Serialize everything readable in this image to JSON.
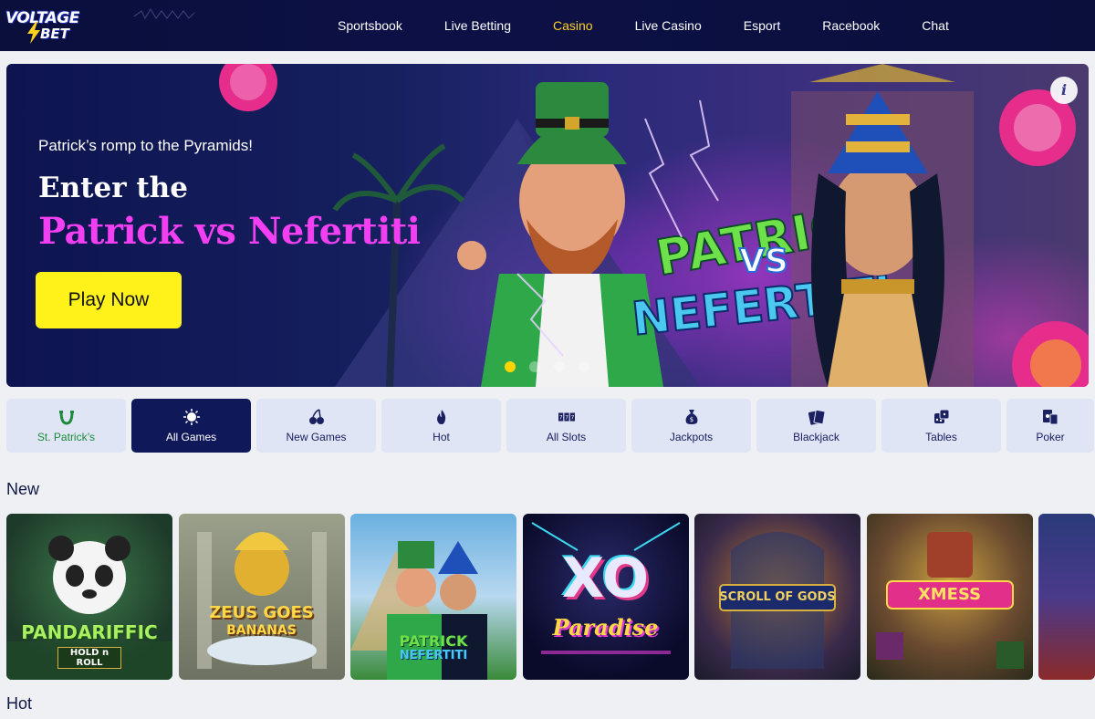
{
  "header": {
    "logo_line1": "VOLTAGE",
    "logo_line2": "BET",
    "nav": [
      {
        "label": "Sportsbook",
        "active": false
      },
      {
        "label": "Live Betting",
        "active": false
      },
      {
        "label": "Casino",
        "active": true
      },
      {
        "label": "Live Casino",
        "active": false
      },
      {
        "label": "Esport",
        "active": false
      },
      {
        "label": "Racebook",
        "active": false
      },
      {
        "label": "Chat",
        "active": false
      }
    ]
  },
  "hero": {
    "subtitle": "Patrick’s romp to the Pyramids!",
    "title_line1": "Enter the",
    "title_line2": "Patrick vs Nefertiti",
    "cta": "Play Now",
    "info_icon": "i",
    "art_text_1": "PATRICK",
    "art_text_2": "VS",
    "art_text_3": "NEFERTITI",
    "slides": 4,
    "active_slide": 1
  },
  "categories": [
    {
      "label": "St. Patrick’s",
      "icon": "horseshoe-icon",
      "active": false
    },
    {
      "label": "All Games",
      "icon": "sun-icon",
      "active": true
    },
    {
      "label": "New Games",
      "icon": "cherries-icon",
      "active": false
    },
    {
      "label": "Hot",
      "icon": "flame-icon",
      "active": false
    },
    {
      "label": "All Slots",
      "icon": "slot-reels-icon",
      "active": false
    },
    {
      "label": "Jackpots",
      "icon": "money-bag-icon",
      "active": false
    },
    {
      "label": "Blackjack",
      "icon": "cards-icon",
      "active": false
    },
    {
      "label": "Tables",
      "icon": "dice-icon",
      "active": false
    },
    {
      "label": "Poker",
      "icon": "poker-cards-icon",
      "active": false
    }
  ],
  "sections": {
    "new_title": "New",
    "hot_title": "Hot"
  },
  "games": [
    {
      "title": "PANDARIFFIC",
      "subtitle": "HOLD n ROLL"
    },
    {
      "title": "ZEUS GOES",
      "subtitle": "BANANAS"
    },
    {
      "title": "PATRICK",
      "subtitle": "NEFERTITI"
    },
    {
      "title": "XO",
      "subtitle": "Paradise"
    },
    {
      "title": "SCROLL OF GODS",
      "subtitle": ""
    },
    {
      "title": "XMESS",
      "subtitle": ""
    },
    {
      "title": "",
      "subtitle": ""
    }
  ],
  "colors": {
    "nav_bg": "#0a0f3c",
    "active_nav": "#ffd21f",
    "cta_bg": "#fff21a",
    "hero_title_pink": "#f23ff2",
    "cat_active_bg": "#0f1858",
    "cat_bg": "#dfe5f5"
  }
}
